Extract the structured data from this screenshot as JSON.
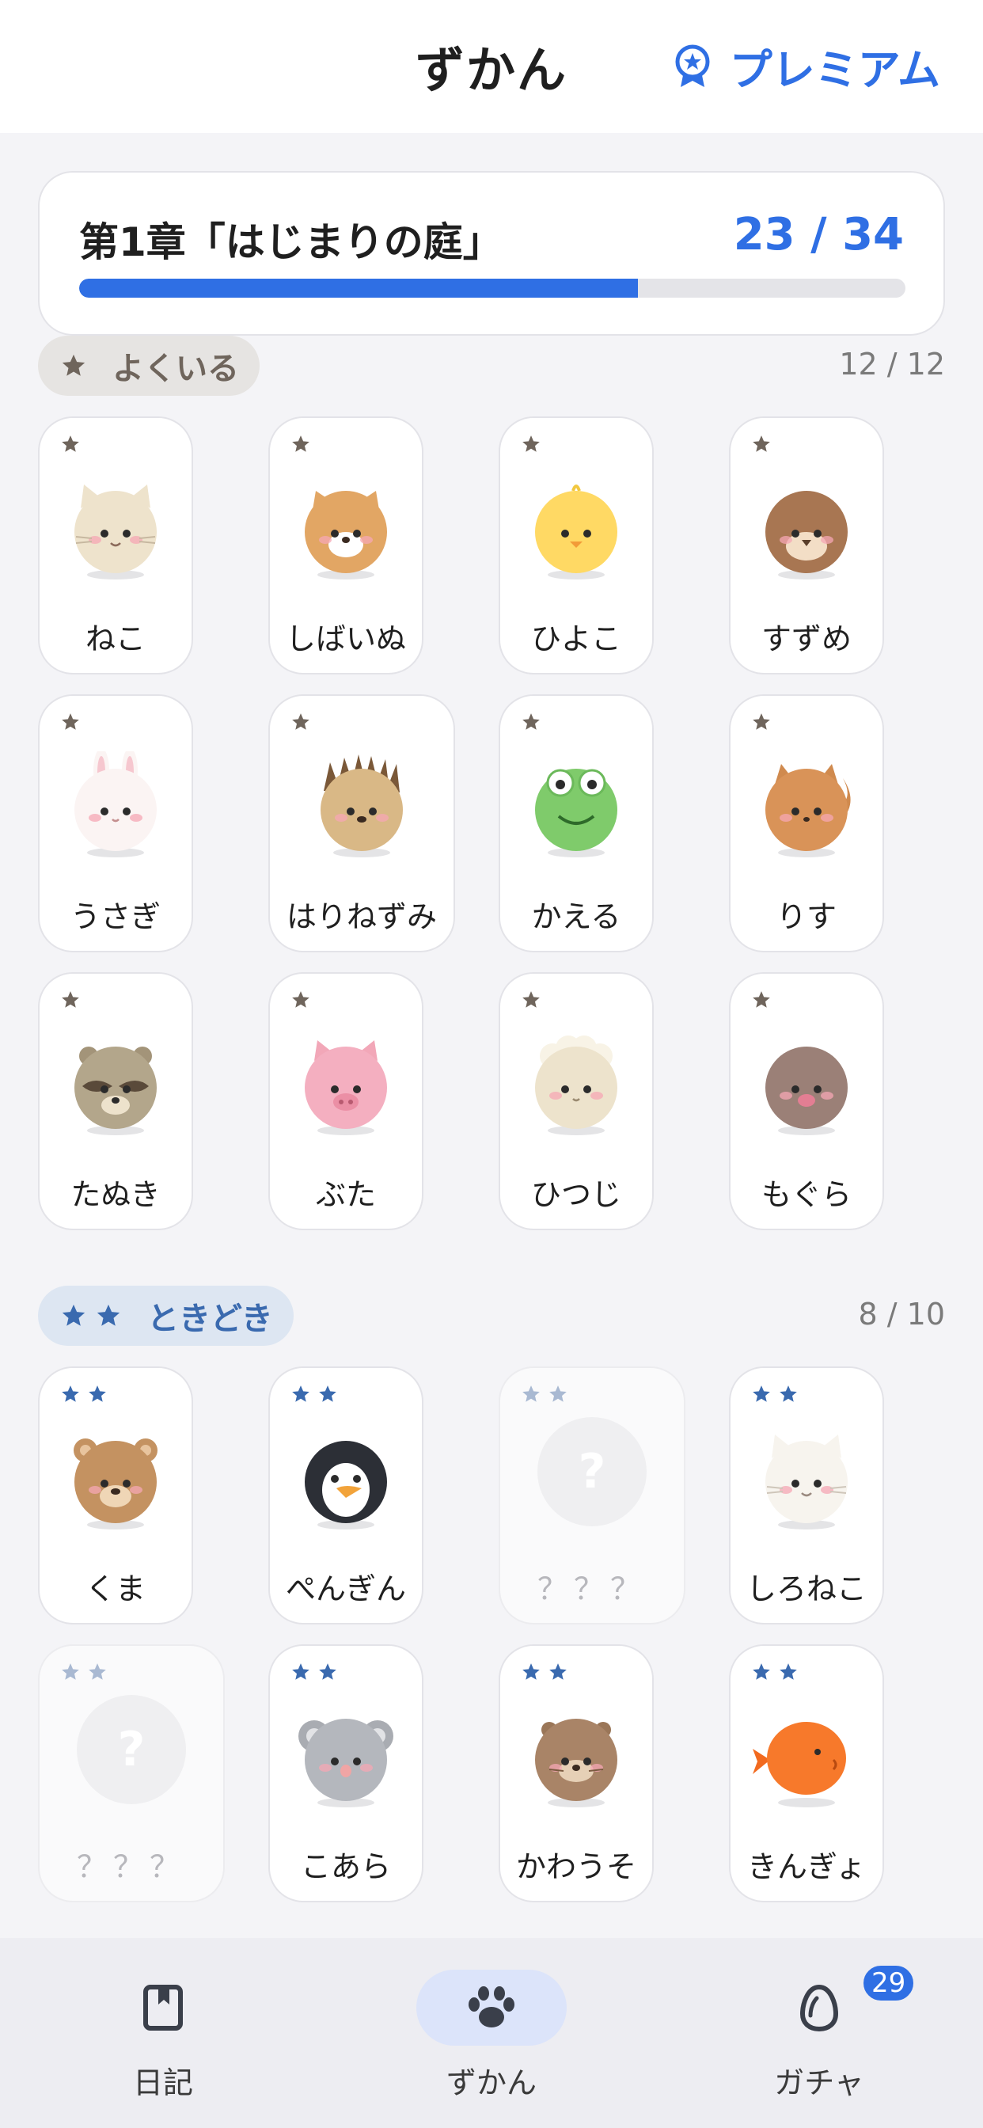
{
  "header": {
    "title": "ずかん",
    "premium_label": "プレミアム",
    "premium_icon": "medal-star-icon",
    "accent_color": "#2F6FE4"
  },
  "chapter": {
    "title": "第1章「はじまりの庭」",
    "progress_text": "23 / 34",
    "collected": 23,
    "total": 34
  },
  "sections": [
    {
      "label": "よくいる",
      "stars": 1,
      "count": "12 / 12",
      "pill_bg": "#E6E4E2",
      "pill_color": "#6F655C",
      "star_color": "#6F655C",
      "cards": [
        {
          "name": "ねこ",
          "animal": "cat"
        },
        {
          "name": "しばいぬ",
          "animal": "shiba"
        },
        {
          "name": "ひよこ",
          "animal": "chick"
        },
        {
          "name": "すずめ",
          "animal": "sparrow"
        },
        {
          "name": "うさぎ",
          "animal": "rabbit"
        },
        {
          "name": "はりねずみ",
          "animal": "hedgehog"
        },
        {
          "name": "かえる",
          "animal": "frog"
        },
        {
          "name": "りす",
          "animal": "squirrel"
        },
        {
          "name": "たぬき",
          "animal": "tanuki"
        },
        {
          "name": "ぶた",
          "animal": "pig"
        },
        {
          "name": "ひつじ",
          "animal": "sheep"
        },
        {
          "name": "もぐら",
          "animal": "mole"
        }
      ]
    },
    {
      "label": "ときどき",
      "stars": 2,
      "count": "8 / 10",
      "pill_bg": "#DDE6F2",
      "pill_color": "#3A6AAF",
      "star_color": "#3A6AAF",
      "cards": [
        {
          "name": "くま",
          "animal": "bear"
        },
        {
          "name": "ぺんぎん",
          "animal": "penguin"
        },
        {
          "name": "？？？",
          "animal": "unknown",
          "locked": true
        },
        {
          "name": "しろねこ",
          "animal": "whitecat"
        },
        {
          "name": "？？？",
          "animal": "unknown",
          "locked": true
        },
        {
          "name": "こあら",
          "animal": "koala"
        },
        {
          "name": "かわうそ",
          "animal": "otter"
        },
        {
          "name": "きんぎょ",
          "animal": "goldfish"
        }
      ]
    }
  ],
  "nav": [
    {
      "label": "日記",
      "icon": "diary-book-icon",
      "active": false
    },
    {
      "label": "ずかん",
      "icon": "paw-icon",
      "active": true
    },
    {
      "label": "ガチャ",
      "icon": "egg-icon",
      "active": false,
      "badge": "29"
    }
  ]
}
